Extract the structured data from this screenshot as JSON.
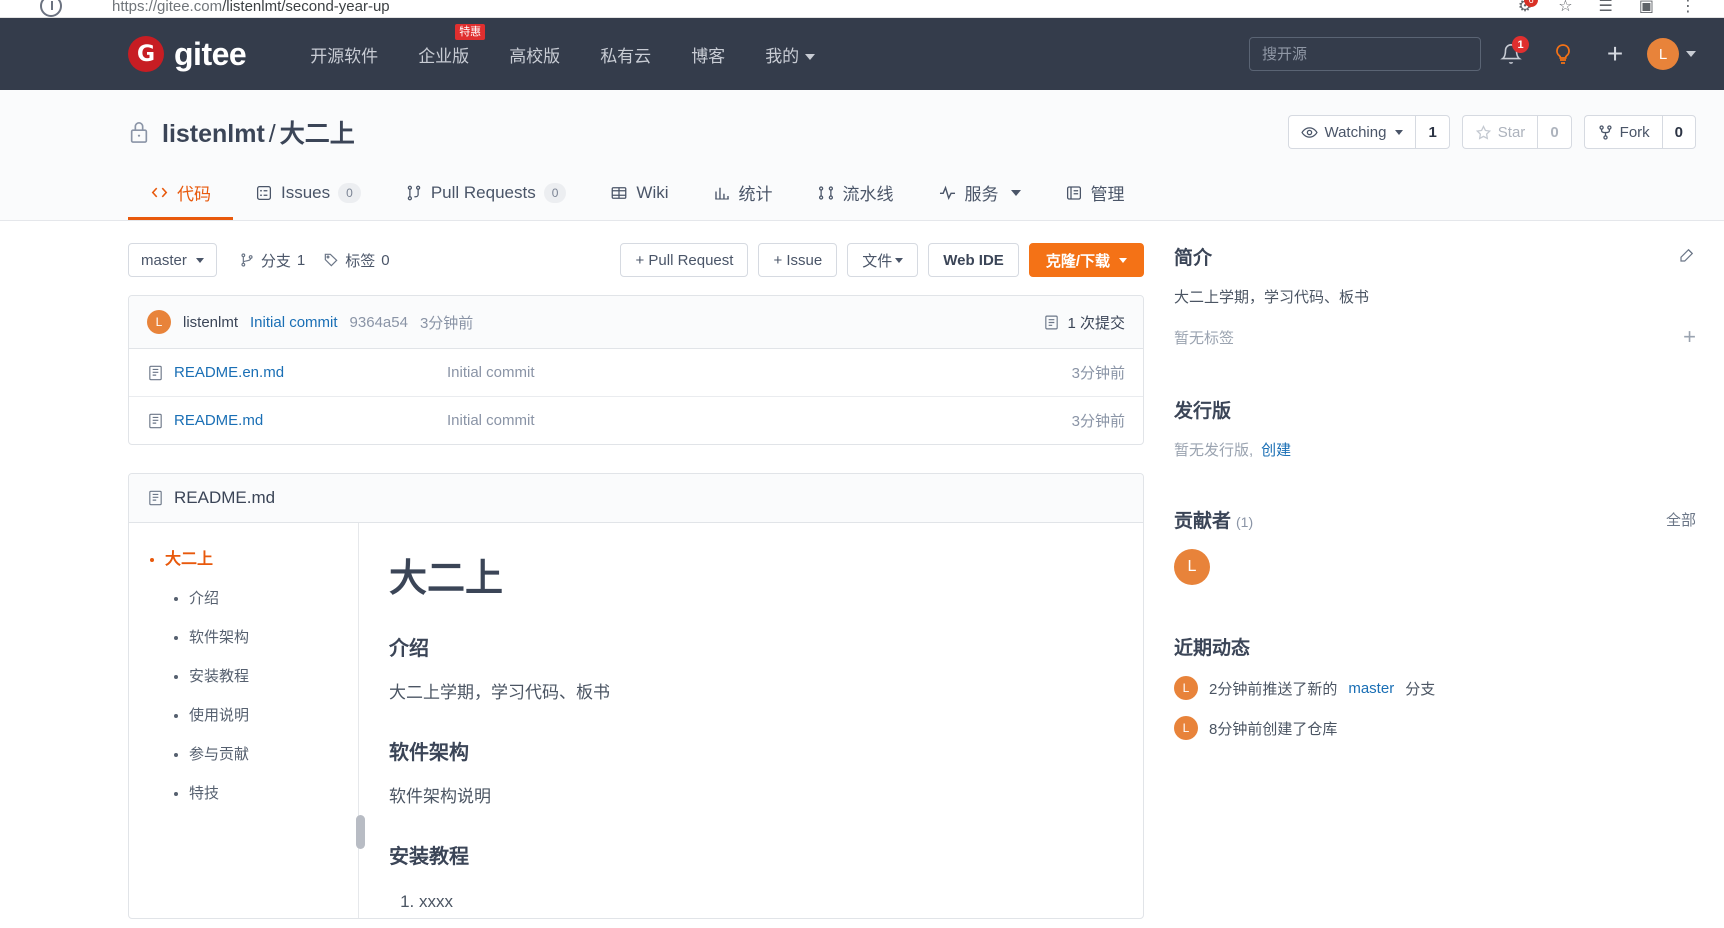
{
  "browser": {
    "url_prefix": "https://",
    "url_domain": "gitee.com",
    "url_path": "/listenlmt/second-year-up",
    "notif_count": "6"
  },
  "topnav": {
    "logo_mark": "G",
    "logo_text": "gitee",
    "items": [
      {
        "label": "开源软件",
        "badge": "",
        "caret": false
      },
      {
        "label": "企业版",
        "badge": "特惠",
        "caret": false
      },
      {
        "label": "高校版",
        "badge": "",
        "caret": false
      },
      {
        "label": "私有云",
        "badge": "",
        "caret": false
      },
      {
        "label": "博客",
        "badge": "",
        "caret": false
      },
      {
        "label": "我的",
        "badge": "",
        "caret": true
      }
    ],
    "search_placeholder": "搜开源",
    "bell_badge": "1",
    "avatar_letter": "L"
  },
  "repo": {
    "owner": "listenlmt",
    "separator": "/",
    "name": "大二上",
    "watching_label": "Watching",
    "watching_count": "1",
    "star_label": "Star",
    "star_count": "0",
    "fork_label": "Fork",
    "fork_count": "0",
    "tabs": [
      {
        "label": "代码",
        "count": "",
        "active": true,
        "caret": false
      },
      {
        "label": "Issues",
        "count": "0",
        "active": false,
        "caret": false
      },
      {
        "label": "Pull Requests",
        "count": "0",
        "active": false,
        "caret": false
      },
      {
        "label": "Wiki",
        "count": "",
        "active": false,
        "caret": false
      },
      {
        "label": "统计",
        "count": "",
        "active": false,
        "caret": false
      },
      {
        "label": "流水线",
        "count": "",
        "active": false,
        "caret": false
      },
      {
        "label": "服务",
        "count": "",
        "active": false,
        "caret": true
      },
      {
        "label": "管理",
        "count": "",
        "active": false,
        "caret": false
      }
    ]
  },
  "toolbar": {
    "branch": "master",
    "branches_label": "分支",
    "branches_count": "1",
    "tags_label": "标签",
    "tags_count": "0",
    "pull_request_btn": "+ Pull Request",
    "issue_btn": "+ Issue",
    "files_btn": "文件",
    "webide_btn": "Web IDE",
    "clone_btn": "克隆/下载"
  },
  "commit": {
    "avatar_letter": "L",
    "author": "listenlmt",
    "message": "Initial commit",
    "sha": "9364a54",
    "time": "3分钟前",
    "count_label": "1 次提交"
  },
  "files": [
    {
      "name": "README.en.md",
      "message": "Initial commit",
      "time": "3分钟前"
    },
    {
      "name": "README.md",
      "message": "Initial commit",
      "time": "3分钟前"
    }
  ],
  "readme": {
    "filename": "README.md",
    "toc_top": "大二上",
    "toc_items": [
      "介绍",
      "软件架构",
      "安装教程",
      "使用说明",
      "参与贡献",
      "特技"
    ],
    "h1": "大二上",
    "sections": [
      {
        "heading": "介绍",
        "text": "大二上学期，学习代码、板书"
      },
      {
        "heading": "软件架构",
        "text": "软件架构说明"
      }
    ],
    "install_heading": "安装教程",
    "install_steps": [
      "xxxx"
    ]
  },
  "sidebar": {
    "intro_title": "简介",
    "intro_text": "大二上学期，学习代码、板书",
    "no_tags": "暂无标签",
    "release_title": "发行版",
    "no_release": "暂无发行版,",
    "create_link": "创建",
    "contrib_title": "贡献者",
    "contrib_count": "(1)",
    "contrib_all": "全部",
    "contributors": [
      {
        "letter": "L"
      }
    ],
    "activity_title": "近期动态",
    "activities": [
      {
        "avatar": "L",
        "pre": "2分钟前推送了新的",
        "link": "master",
        "post": "分支"
      },
      {
        "avatar": "L",
        "pre": "8分钟前创建了仓库",
        "link": "",
        "post": ""
      }
    ]
  },
  "colors": {
    "brand_orange": "#f47216",
    "nav_dark": "#343c4b",
    "link_blue": "#1a6fb5",
    "logo_red": "#c71d23"
  }
}
